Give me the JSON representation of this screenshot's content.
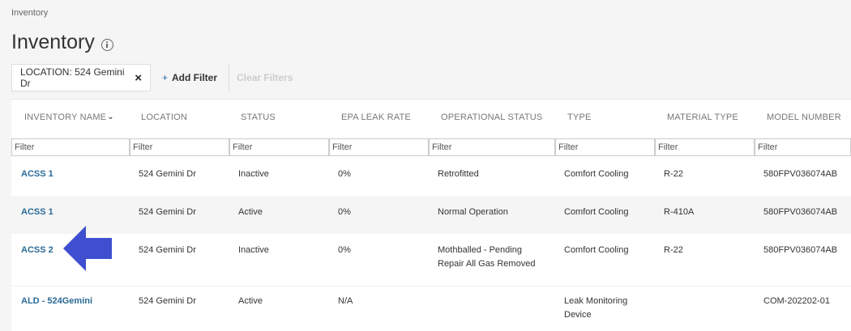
{
  "breadcrumb": "Inventory",
  "page_title": "Inventory",
  "filters": {
    "active_chip": "LOCATION: 524 Gemini Dr",
    "add_filter_label": "Add Filter",
    "add_filter_icon": "+",
    "clear_filters_label": "Clear Filters"
  },
  "table": {
    "columns": [
      "INVENTORY NAME",
      "LOCATION",
      "STATUS",
      "EPA LEAK RATE",
      "OPERATIONAL STATUS",
      "TYPE",
      "MATERIAL TYPE",
      "MODEL NUMBER"
    ],
    "sort_icon": "chevron-down",
    "filter_placeholder": "Filter",
    "rows": [
      {
        "name": "ACSS 1",
        "location": "524 Gemini Dr",
        "status": "Inactive",
        "epa": "0%",
        "op_status": "Retrofitted",
        "type": "Comfort Cooling",
        "material": "R-22",
        "model": "580FPV036074AB"
      },
      {
        "name": "ACSS 1",
        "location": "524 Gemini Dr",
        "status": "Active",
        "epa": "0%",
        "op_status": "Normal Operation",
        "type": "Comfort Cooling",
        "material": "R-410A",
        "model": "580FPV036074AB"
      },
      {
        "name": "ACSS 2",
        "location": "524 Gemini Dr",
        "status": "Inactive",
        "epa": "0%",
        "op_status": "Mothballed - Pending Repair All Gas Removed",
        "type": "Comfort Cooling",
        "material": "R-22",
        "model": "580FPV036074AB"
      },
      {
        "name": "ALD - 524Gemini",
        "location": "524 Gemini Dr",
        "status": "Active",
        "epa": "N/A",
        "op_status": "",
        "type": "Leak Monitoring Device",
        "material": "",
        "model": "COM-202202-01"
      }
    ]
  },
  "colors": {
    "link": "#2a6a96",
    "arrow": "#3f4fd0"
  },
  "annotation": {
    "icon": "left-arrow-icon"
  }
}
